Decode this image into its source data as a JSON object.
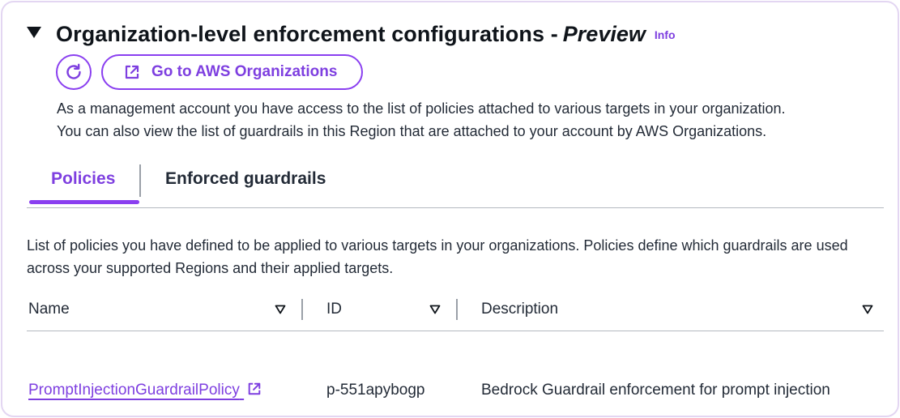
{
  "header": {
    "title": "Organization-level enforcement configurations -",
    "title_suffix": "Preview",
    "info_label": "Info"
  },
  "actions": {
    "refresh_icon": "refresh-icon",
    "org_button_label": "Go to AWS Organizations",
    "org_button_icon": "external-link-icon"
  },
  "description": {
    "line1": "As a management account you have access to the list of policies attached to various targets in your organization.",
    "line2": "You can also view the list of guardrails in this Region that are attached to your account by AWS Organizations."
  },
  "tabs": [
    {
      "label": "Policies",
      "active": true
    },
    {
      "label": "Enforced guardrails",
      "active": false
    }
  ],
  "list_description": "List of policies you have defined to be applied to various targets in your organizations. Policies define which guardrails are used across your supported Regions and their applied targets.",
  "table": {
    "columns": [
      "Name",
      "ID",
      "Description"
    ],
    "rows": [
      {
        "name": "PromptInjectionGuardrailPolicy",
        "id": "p-551apybogp",
        "description": "Bedrock Guardrail enforcement for prompt injection"
      }
    ]
  },
  "colors": {
    "accent": "#8a3ff0",
    "link": "#7e3fe0",
    "text": "#0f141a",
    "border": "#e3d6f2"
  }
}
